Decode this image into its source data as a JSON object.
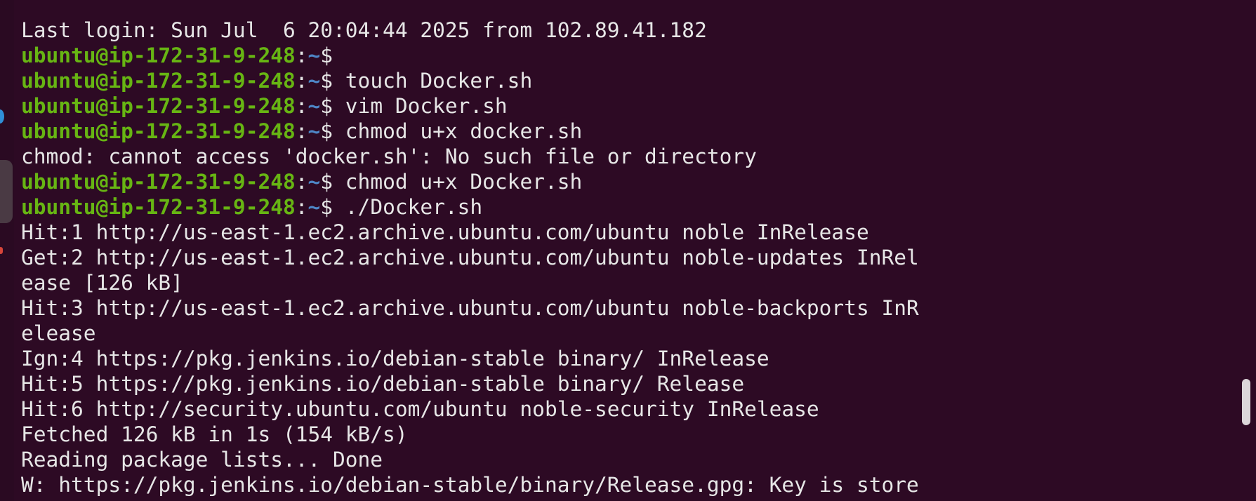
{
  "terminal": {
    "colors": {
      "background": "#2d0a24",
      "text": "#e6e6e6",
      "prompt_user": "#67b513",
      "prompt_path": "#4e86c6"
    },
    "login_line": "Last login: Sun Jul  6 20:04:44 2025 from 102.89.41.182",
    "prompt": {
      "user_host": "ubuntu@ip-172-31-9-248",
      "separator": ":",
      "path": "~",
      "symbol": "$"
    },
    "commands": [
      "",
      " touch Docker.sh",
      " vim Docker.sh",
      " chmod u+x docker.sh",
      " chmod u+x Docker.sh",
      " ./Docker.sh"
    ],
    "error_line": "chmod: cannot access 'docker.sh': No such file or directory",
    "output": [
      "Hit:1 http://us-east-1.ec2.archive.ubuntu.com/ubuntu noble InRelease",
      "Get:2 http://us-east-1.ec2.archive.ubuntu.com/ubuntu noble-updates InRel",
      "ease [126 kB]",
      "Hit:3 http://us-east-1.ec2.archive.ubuntu.com/ubuntu noble-backports InR",
      "elease",
      "Ign:4 https://pkg.jenkins.io/debian-stable binary/ InRelease",
      "Hit:5 https://pkg.jenkins.io/debian-stable binary/ Release",
      "Hit:6 http://security.ubuntu.com/ubuntu noble-security InRelease",
      "Fetched 126 kB in 1s (154 kB/s)",
      "Reading package lists... Done",
      "W: https://pkg.jenkins.io/debian-stable/binary/Release.gpg: Key is store"
    ]
  }
}
